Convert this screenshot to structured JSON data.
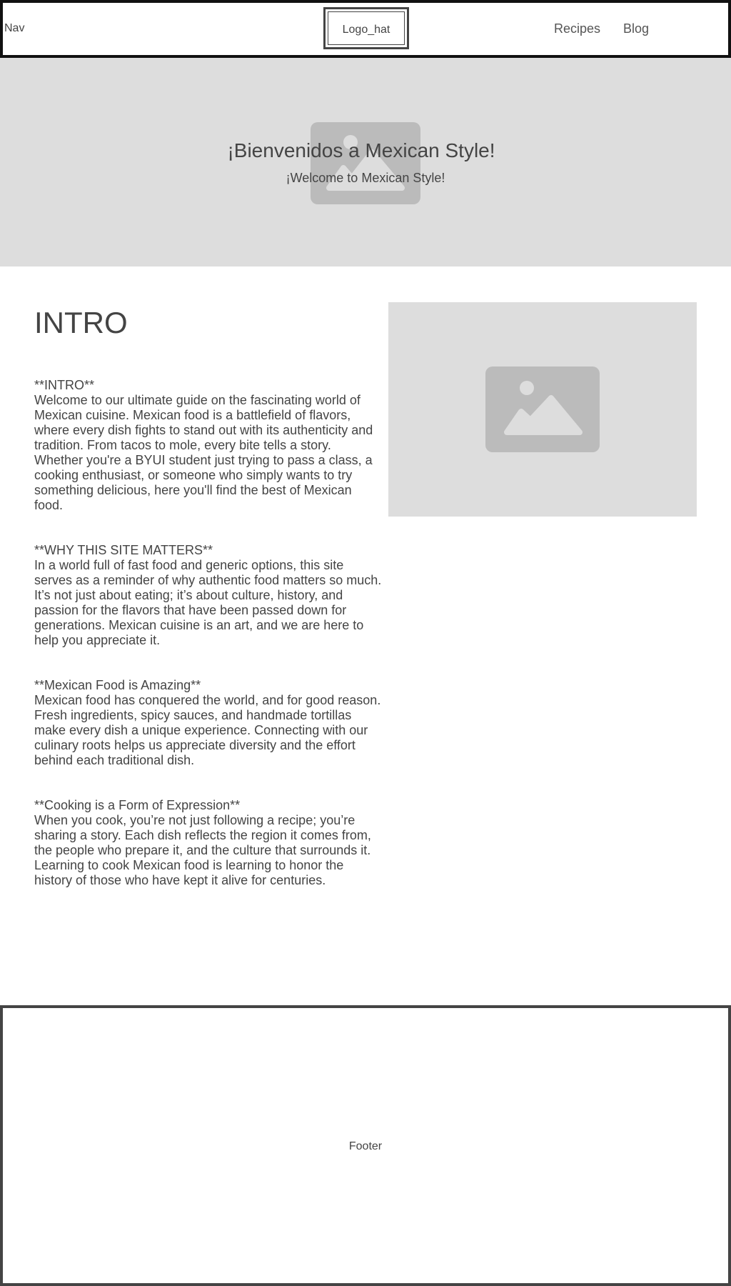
{
  "nav": {
    "label": "Nav",
    "logo": "Logo_hat",
    "links": [
      "Recipes",
      "Blog"
    ]
  },
  "hero": {
    "title": "¡Bienvenidos a Mexican Style!",
    "subtitle": "¡Welcome to Mexican Style!",
    "image_icon": "image-placeholder-icon"
  },
  "main": {
    "heading": "INTRO",
    "side_image_icon": "image-placeholder-icon",
    "sections": [
      {
        "title": "**INTRO**",
        "body": "Welcome to our ultimate guide on the fascinating world of Mexican cuisine. Mexican food is a battlefield of flavors, where every dish fights to stand out with its authenticity and tradition. From tacos to mole, every bite tells a story. Whether you're a BYUI student just trying to pass a class, a cooking enthusiast, or someone who simply wants to try something delicious, here you'll find the best of Mexican food."
      },
      {
        "title": "**WHY THIS SITE MATTERS**",
        "body": "In a world full of fast food and generic options, this site serves as a reminder of why authentic food matters so much. It’s not just about eating; it’s about culture, history, and passion for the flavors that have been passed down for generations. Mexican cuisine is an art, and we are here to help you appreciate it."
      },
      {
        "title": "**Mexican Food is Amazing**",
        "body": "Mexican food has conquered the world, and for good reason. Fresh ingredients, spicy sauces, and handmade tortillas make every dish a unique experience. Connecting with our culinary roots helps us appreciate diversity and the effort behind each traditional dish."
      },
      {
        "title": "**Cooking is a Form of Expression**",
        "body": "When you cook, you’re not just following a recipe; you’re sharing a story. Each dish reflects the region it comes from, the people who prepare it, and the culture that surrounds it. Learning to cook Mexican food is learning to honor the history of those who have kept it alive for centuries."
      }
    ]
  },
  "footer": {
    "label": "Footer"
  },
  "colors": {
    "placeholder_bg": "#dddddd",
    "placeholder_icon": "#bbbbbb",
    "text": "#444444",
    "border": "#111111"
  }
}
